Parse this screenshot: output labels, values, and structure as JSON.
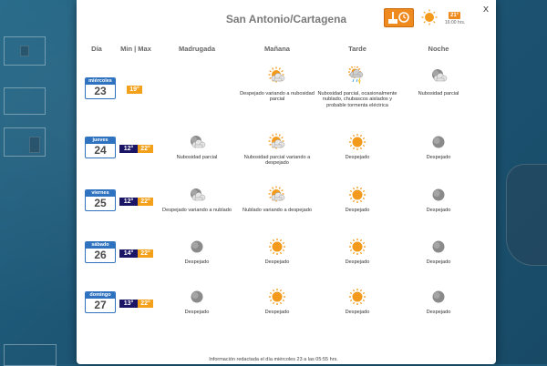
{
  "location": "San Antonio/Cartagena",
  "close_label": "x",
  "current": {
    "temp": "21°",
    "time": "16:00 hrs."
  },
  "headers": [
    "Día",
    "Min | Max",
    "Madrugada",
    "Mañana",
    "Tarde",
    "Noche"
  ],
  "days": [
    {
      "name": "miércoles",
      "num": "23",
      "single_temp": "19°",
      "periods": [
        null,
        {
          "icon": "sun-cloud",
          "desc": "Despejado variando a nubosidad parcial"
        },
        {
          "icon": "storm",
          "desc": "Nubosidad parcial, ocasionalmente nublado, chubascos aislados y probable tormenta eléctrica"
        },
        {
          "icon": "moon-cloud",
          "desc": "Nubosidad parcial"
        }
      ]
    },
    {
      "name": "jueves",
      "num": "24",
      "min": "12°",
      "max": "22°",
      "periods": [
        {
          "icon": "moon-cloud",
          "desc": "Nubosidad parcial"
        },
        {
          "icon": "sun-cloud",
          "desc": "Nubosidad parcial variando a despejado"
        },
        {
          "icon": "sun",
          "desc": "Despejado"
        },
        {
          "icon": "moon",
          "desc": "Despejado"
        }
      ]
    },
    {
      "name": "viernes",
      "num": "25",
      "min": "12°",
      "max": "22°",
      "periods": [
        {
          "icon": "moon-cloud",
          "desc": "Despejado variando a nublado"
        },
        {
          "icon": "sun-cloud",
          "desc": "Nublado variando a despejado"
        },
        {
          "icon": "sun",
          "desc": "Despejado"
        },
        {
          "icon": "moon",
          "desc": "Despejado"
        }
      ]
    },
    {
      "name": "sábado",
      "num": "26",
      "min": "14°",
      "max": "22°",
      "periods": [
        {
          "icon": "moon",
          "desc": "Despejado"
        },
        {
          "icon": "sun",
          "desc": "Despejado"
        },
        {
          "icon": "sun",
          "desc": "Despejado"
        },
        {
          "icon": "moon",
          "desc": "Despejado"
        }
      ]
    },
    {
      "name": "domingo",
      "num": "27",
      "min": "13°",
      "max": "22°",
      "periods": [
        {
          "icon": "moon",
          "desc": "Despejado"
        },
        {
          "icon": "sun",
          "desc": "Despejado"
        },
        {
          "icon": "sun",
          "desc": "Despejado"
        },
        {
          "icon": "moon",
          "desc": "Despejado"
        }
      ]
    }
  ],
  "footer": "Información redactada el día miércoles 23 a las 05:55 hrs.",
  "colors": {
    "accent_orange": "#ef8a1e",
    "badge_blue": "#2f73c0",
    "min_navy": "#1b1566",
    "max_orange": "#f3a11a"
  }
}
